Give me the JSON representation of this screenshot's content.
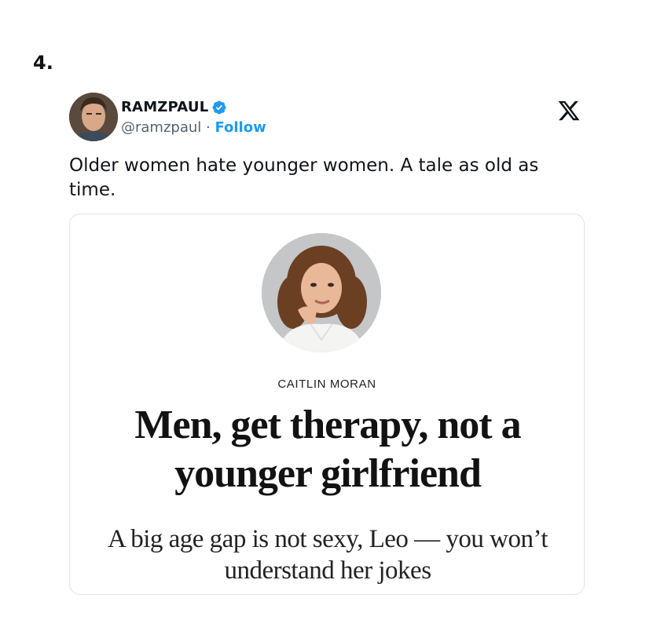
{
  "list_number": "4.",
  "tweet": {
    "display_name": "RAMZPAUL",
    "handle": "@ramzpaul",
    "separator": " · ",
    "follow_label": "Follow",
    "text": "Older women hate younger women. A tale as old as time."
  },
  "icons": {
    "verified": "verified-badge-icon",
    "platform": "x-logo-icon"
  },
  "card": {
    "author": "CAITLIN MORAN",
    "headline": "Men, get therapy, not a younger girlfriend",
    "subheadline": "A big age gap is not sexy, Leo — you won’t understand her jokes"
  },
  "colors": {
    "follow": "#1d9bf0",
    "verified": "#1d9bf0",
    "text": "#0f1419",
    "muted": "#536471"
  }
}
